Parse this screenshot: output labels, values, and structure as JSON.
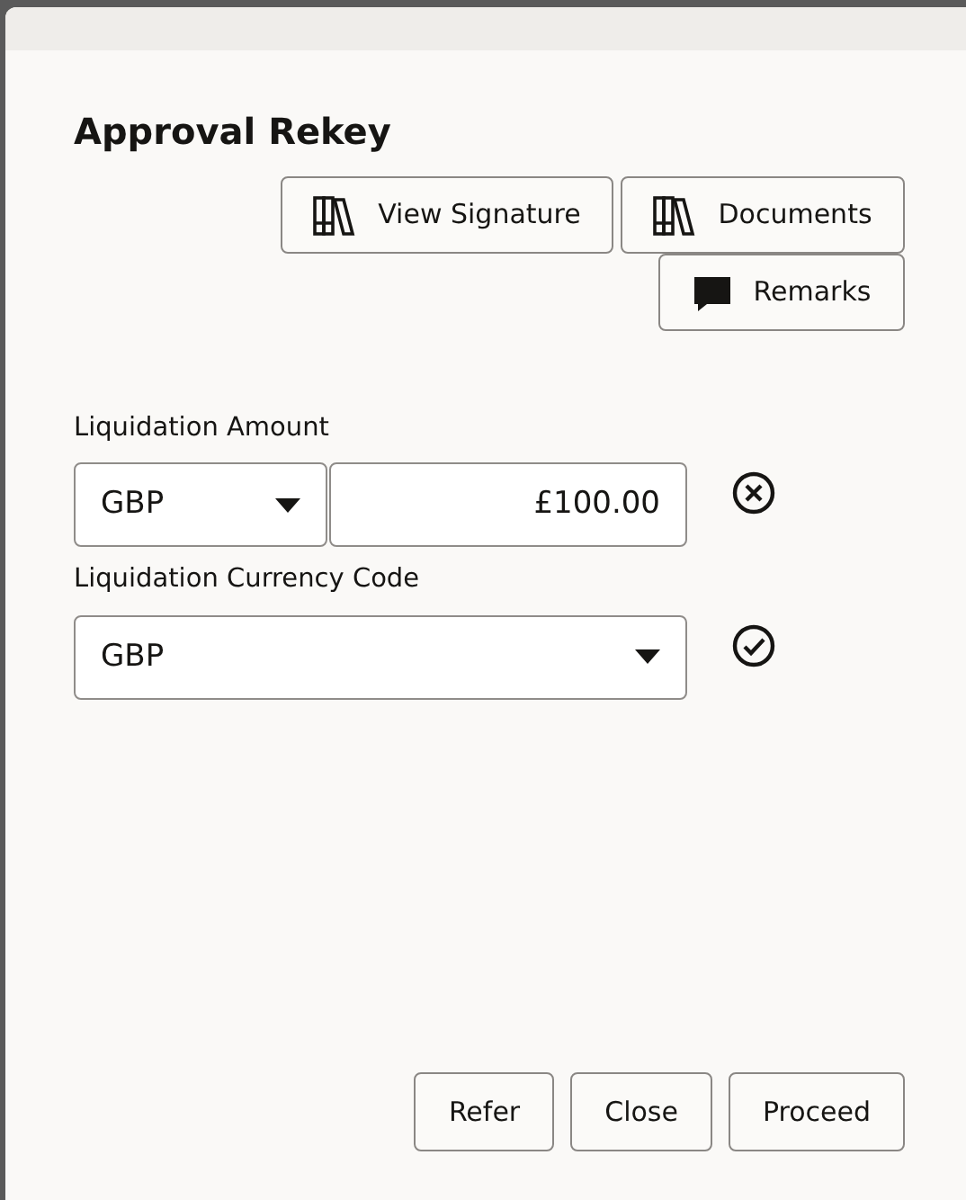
{
  "dialog": {
    "title": "Approval Rekey"
  },
  "actions": [
    {
      "label": "View Signature",
      "kind": "books"
    },
    {
      "label": "Documents",
      "kind": "books"
    },
    {
      "label": "Remarks",
      "kind": "comment"
    }
  ],
  "fields": [
    {
      "kind": "currency-amount",
      "label": "Liquidation Amount",
      "currency": "GBP",
      "value": "£100.00",
      "valid": false
    },
    {
      "kind": "select",
      "label": "Liquidation Currency Code",
      "value": "GBP",
      "valid": true
    }
  ],
  "footer_buttons": [
    "Refer",
    "Close",
    "Proceed"
  ]
}
